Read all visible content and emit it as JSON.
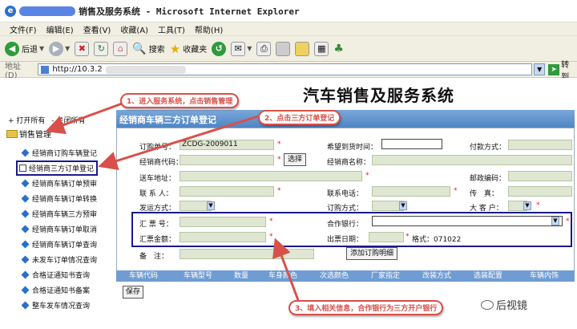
{
  "window": {
    "title": "销售及服务系统 - Microsoft Internet Explorer"
  },
  "menu": [
    "文件(F)",
    "编辑(E)",
    "查看(V)",
    "收藏(A)",
    "工具(T)",
    "帮助(H)"
  ],
  "toolbar": {
    "back": "后退",
    "search": "搜索",
    "favorites": "收藏夹"
  },
  "address": {
    "label": "地址(D)",
    "url": "http://10.3.2",
    "go": "转到"
  },
  "page": {
    "system_title": "汽车销售及服务系统"
  },
  "nav": {
    "expand_all": "+ 打开所有",
    "collapse_all": "- 关闭所有",
    "root": "销售管理",
    "items": [
      "经销商订购车辆登记",
      "经销商三方订单登记",
      "经销商车辆订单预审",
      "经销商车辆订单转换",
      "经销商车辆三方预审",
      "经销商车辆订单取消",
      "经销商车辆订单查询",
      "未发车订单情况查询",
      "合格证通知书查询",
      "合格证通知书备案",
      "整车发车情况查询"
    ]
  },
  "form": {
    "heading": "经销商车辆三方订单登记",
    "order_no_label": "订购单号：",
    "order_no_value": "ZCDG-2009011",
    "expected_time_label": "希望到货时间：",
    "payment_label": "付款方式：",
    "dealer_code_label": "经销商代码：",
    "select_button": "选择",
    "dealer_name_label": "经销商名称：",
    "ship_addr_label": "送车地址：",
    "postal_label": "邮政编码：",
    "contact_label": "联 系 人：",
    "phone_label": "联系电话：",
    "fax_label": "传　真：",
    "ship_method_label": "发运方式：",
    "order_method_label": "订购方式：",
    "big_customer_label": "大 客 户：",
    "remit_no_label": "汇 票 号：",
    "bank_label": "合作银行：",
    "remit_amount_label": "汇票金额：",
    "issue_date_label": "出票日期：",
    "date_format": "格式：071022",
    "remark_label": "备　注：",
    "add_detail_button": "添加订购明细",
    "save_button": "保存"
  },
  "table": {
    "columns": [
      "车辆代码",
      "车辆型号",
      "数量",
      "车身颜色",
      "次选颜色",
      "厂家指定",
      "改装方式",
      "选装配置",
      "车辆内饰"
    ]
  },
  "callouts": {
    "step1": "1、进入服务系统，点击销售管理",
    "step2": "2、点击三方订单登记",
    "step3": "3、填入相关信息，合作银行为三方开户银行"
  },
  "watermark": "后视镜",
  "colors": {
    "accent": "#d8504a",
    "highlight_box": "#1a1a8a",
    "form_header": "#4f85c4"
  }
}
